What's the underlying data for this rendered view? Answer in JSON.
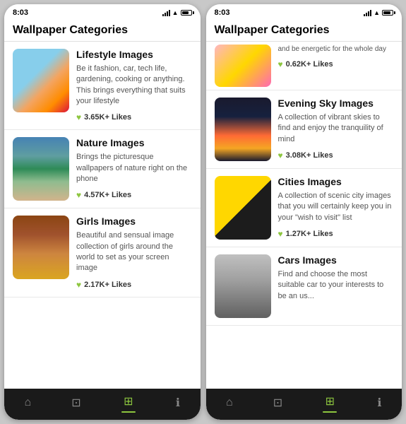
{
  "phone1": {
    "status_time": "8:03",
    "page_title": "Wallpaper Categories",
    "categories": [
      {
        "id": "lifestyle",
        "name": "Lifestyle Images",
        "description": "Be it fashion, car, tech life, gardening, cooking or anything. This brings everything that suits your lifestyle",
        "likes": "3.65K+ Likes",
        "img_class": "img-umbrellas"
      },
      {
        "id": "nature",
        "name": "Nature Images",
        "description": "Brings the picturesque wallpapers of nature right on the phone",
        "likes": "4.57K+ Likes",
        "img_class": "img-nature"
      },
      {
        "id": "girls",
        "name": "Girls Images",
        "description": "Beautiful and sensual image collection of girls around the world to set as your screen image",
        "likes": "2.17K+ Likes",
        "img_class": "img-girls"
      }
    ],
    "nav_items": [
      {
        "id": "home",
        "icon": "⌂",
        "label": ""
      },
      {
        "id": "login",
        "icon": "⊡",
        "label": ""
      },
      {
        "id": "gallery",
        "icon": "⊞",
        "label": "",
        "active": true
      },
      {
        "id": "info",
        "icon": "ℹ",
        "label": ""
      }
    ]
  },
  "phone2": {
    "status_time": "8:03",
    "page_title": "Wallpaper Categories",
    "partial_top": {
      "description": "and be energetic for the whole day",
      "likes": "0.62K+ Likes",
      "img_class": "img-pink"
    },
    "categories": [
      {
        "id": "evening",
        "name": "Evening Sky Images",
        "description": "A collection of vibrant skies to find and enjoy the tranquility of mind",
        "likes": "3.08K+ Likes",
        "img_class": "img-evening"
      },
      {
        "id": "cities",
        "name": "Cities Images",
        "description": "A collection of scenic city images that you will certainly keep you in your \"wish to visit\" list",
        "likes": "1.27K+ Likes",
        "img_class": "img-cities"
      },
      {
        "id": "cars",
        "name": "Cars Images",
        "description": "Find and choose the most suitable car to your interests to be an us...",
        "likes": "",
        "img_class": "img-cars"
      }
    ],
    "nav_items": [
      {
        "id": "home",
        "icon": "⌂",
        "label": ""
      },
      {
        "id": "login",
        "icon": "⊡",
        "label": ""
      },
      {
        "id": "gallery",
        "icon": "⊞",
        "label": "",
        "active": true
      },
      {
        "id": "info",
        "icon": "ℹ",
        "label": ""
      }
    ]
  },
  "colors": {
    "accent": "#8dc63f",
    "dark_nav": "#1a1a1a"
  }
}
